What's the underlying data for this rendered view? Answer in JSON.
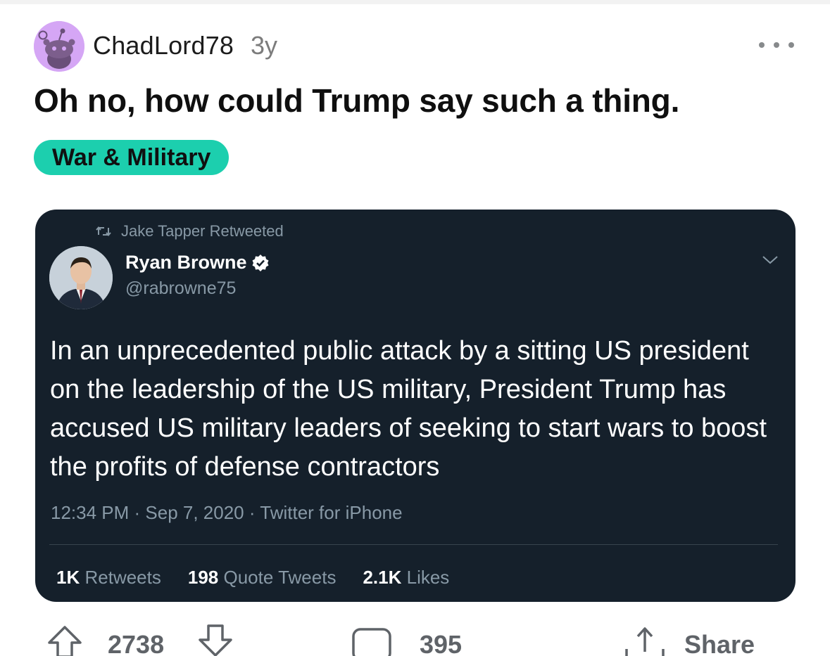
{
  "post": {
    "username": "ChadLord78",
    "age": "3y",
    "title": "Oh no, how could Trump say such a thing.",
    "flair": "War & Military",
    "flair_color": "#1ccfae",
    "avatar_color": "#d5a6f5"
  },
  "tweet": {
    "retweeted_by": "Jake Tapper Retweeted",
    "author_name": "Ryan Browne",
    "author_handle": "@rabrowne75",
    "verified_icon": "verified-badge-icon",
    "body": "In an unprecedented public attack by a sitting US president on the leadership of the US military, President Trump has accused US military leaders of seeking to start wars to boost the profits of defense contractors",
    "meta": "12:34 PM · Sep 7, 2020 · Twitter for iPhone",
    "retweets_count": "1K",
    "retweets_label": "Retweets",
    "quotes_count": "198",
    "quotes_label": "Quote Tweets",
    "likes_count": "2.1K",
    "likes_label": "Likes",
    "background": "#15202b"
  },
  "actions": {
    "upvotes": "2738",
    "comments": "395",
    "share_label": "Share"
  }
}
